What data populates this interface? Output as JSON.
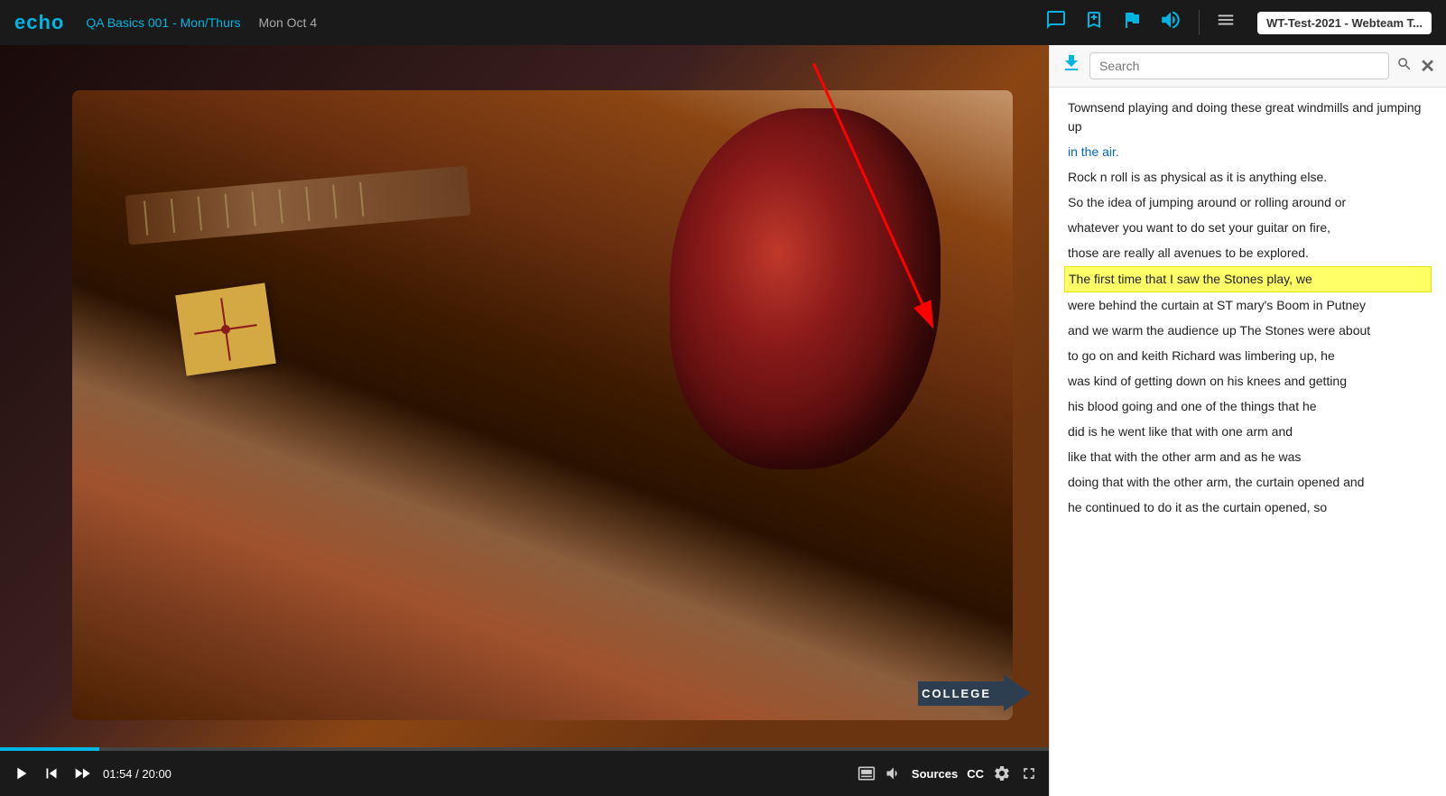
{
  "header": {
    "logo": "echo",
    "course": "QA Basics 001 - Mon/Thurs",
    "date": "Mon Oct 4",
    "panel_title": "WT-Test-2021 - Webteam T..."
  },
  "search": {
    "placeholder": "Search"
  },
  "video": {
    "current_time": "01:54",
    "total_time": "20:00",
    "progress_pct": 9.5
  },
  "controls": {
    "play": "▶",
    "rewind": "⏮",
    "fast_forward": "⏭",
    "sources": "Sources",
    "cc": "CC"
  },
  "transcript": {
    "lines": [
      {
        "id": 1,
        "text": "Townsend playing and doing these great windmills and jumping up",
        "highlighted": false,
        "blue": false
      },
      {
        "id": 2,
        "text": "in the air.",
        "highlighted": false,
        "blue": true
      },
      {
        "id": 3,
        "text": "Rock n roll is as physical as it is anything else.",
        "highlighted": false,
        "blue": false
      },
      {
        "id": 4,
        "text": "So the idea of jumping around or rolling around or",
        "highlighted": false,
        "blue": false
      },
      {
        "id": 5,
        "text": "whatever you want to do set your guitar on fire,",
        "highlighted": false,
        "blue": false
      },
      {
        "id": 6,
        "text": "those are really all avenues to be explored.",
        "highlighted": false,
        "blue": false
      },
      {
        "id": 7,
        "text": "The first time that I saw the Stones play, we",
        "highlighted": true,
        "blue": false
      },
      {
        "id": 8,
        "text": "were behind the curtain at ST mary's Boom in Putney",
        "highlighted": false,
        "blue": false
      },
      {
        "id": 9,
        "text": "and we warm the audience up The Stones were about",
        "highlighted": false,
        "blue": false
      },
      {
        "id": 10,
        "text": "to go on and keith Richard was limbering up, he",
        "highlighted": false,
        "blue": false
      },
      {
        "id": 11,
        "text": "was kind of getting down on his knees and getting",
        "highlighted": false,
        "blue": false
      },
      {
        "id": 12,
        "text": "his blood going and one of the things that he",
        "highlighted": false,
        "blue": false
      },
      {
        "id": 13,
        "text": "did is he went like that with one arm and",
        "highlighted": false,
        "blue": false
      },
      {
        "id": 14,
        "text": "like that with the other arm and as he was",
        "highlighted": false,
        "blue": false
      },
      {
        "id": 15,
        "text": "doing that with the other arm, the curtain opened and",
        "highlighted": false,
        "blue": false
      },
      {
        "id": 16,
        "text": "he continued to do it as the curtain opened, so",
        "highlighted": false,
        "blue": false
      }
    ]
  },
  "icons": {
    "chat": "💬",
    "bookmark_add": "🔖",
    "flag": "🚩",
    "audio": "🔊",
    "menu": "☰",
    "download": "⬇",
    "search_symbol": "🔍",
    "picture": "🖼",
    "volume": "🔊",
    "settings": "⚙",
    "expand": "⊞",
    "close": "✕"
  },
  "college_badge": "COLLEGE"
}
